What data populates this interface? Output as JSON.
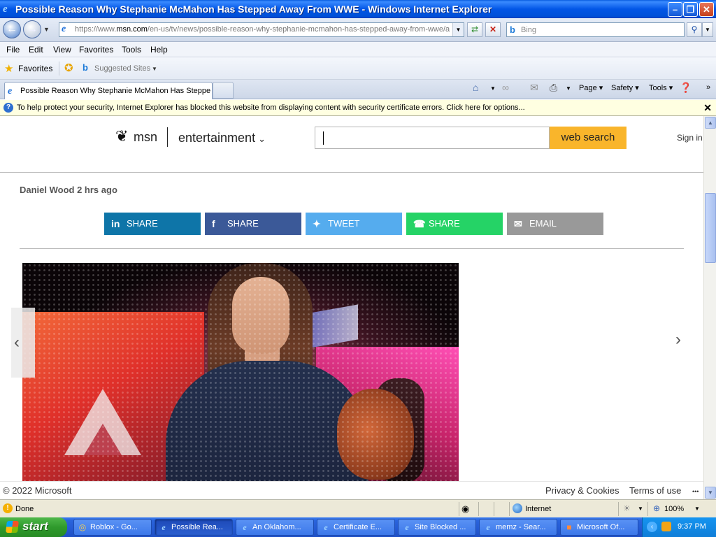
{
  "window": {
    "title": "Possible Reason Why Stephanie McMahon Has Stepped Away From WWE - Windows Internet Explorer",
    "min_label": "–",
    "restore_label": "❐",
    "close_label": "✕"
  },
  "address": {
    "url_prefix": "https://www.",
    "url_domain": "msn.com",
    "url_rest": "/en-us/tv/news/possible-reason-why-stephanie-mcmahon-has-stepped-away-from-wwe/a",
    "search_placeholder": "Bing"
  },
  "menu": [
    "File",
    "Edit",
    "View",
    "Favorites",
    "Tools",
    "Help"
  ],
  "favorites": {
    "label": "Favorites",
    "suggested": "Suggested Sites"
  },
  "tab": {
    "label": "Possible Reason Why Stephanie McMahon Has Steppe..."
  },
  "commands": {
    "page": "Page",
    "safety": "Safety",
    "tools": "Tools"
  },
  "infobar": {
    "message": "To help protect your security, Internet Explorer has blocked this website from displaying content with security certificate errors. Click here for options..."
  },
  "site": {
    "logo": "msn",
    "section": "entertainment",
    "search_button": "web search",
    "sign_in": "Sign in",
    "author_line": "Daniel Wood 2 hrs ago",
    "share_buttons": [
      {
        "label": "SHARE",
        "icon": "in",
        "color": "#0e75a8"
      },
      {
        "label": "SHARE",
        "icon": "f",
        "color": "#3b5998"
      },
      {
        "label": "TWEET",
        "icon": "✦",
        "color": "#55acee"
      },
      {
        "label": "SHARE",
        "icon": "☎",
        "color": "#25d366"
      },
      {
        "label": "EMAIL",
        "icon": "✉",
        "color": "#999999"
      }
    ]
  },
  "footer": {
    "copyright": "© 2022 Microsoft",
    "privacy": "Privacy & Cookies",
    "terms": "Terms of use",
    "more": "•••"
  },
  "status": {
    "text": "Done",
    "zone": "Internet",
    "zoom": "100%"
  },
  "taskbar": {
    "start": "start",
    "tasks": [
      {
        "label": "Roblox - Go...",
        "icon": "chrome-icon"
      },
      {
        "label": "Possible Rea...",
        "icon": "ie-icon"
      },
      {
        "label": "An Oklahom...",
        "icon": "ie-icon"
      },
      {
        "label": "Certificate E...",
        "icon": "ie-icon"
      },
      {
        "label": "Site Blocked ...",
        "icon": "ie-icon"
      },
      {
        "label": "memz - Sear...",
        "icon": "ie-icon"
      },
      {
        "label": "Microsoft Of...",
        "icon": "office-icon"
      }
    ],
    "active_index": 1,
    "clock": "9:37 PM"
  }
}
